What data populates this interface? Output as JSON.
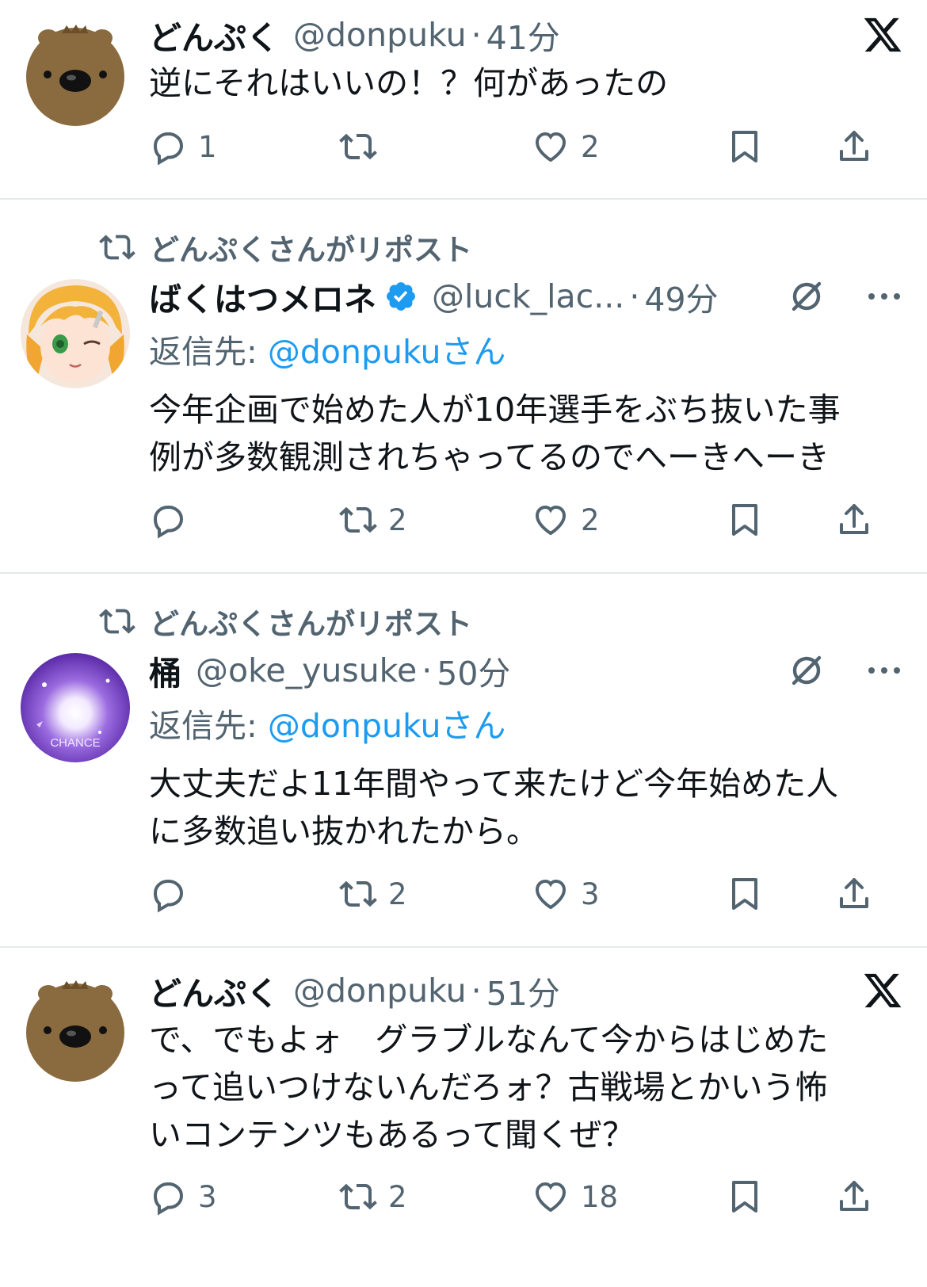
{
  "tweets": [
    {
      "name": "どんぷく",
      "handle": "@donpuku",
      "time": "41分",
      "text_lines": [
        "逆にそれはいいの！？何があったの"
      ],
      "counts": {
        "reply": "1",
        "repost": "",
        "like": "2"
      }
    },
    {
      "repost_label": "どんぷくさんがリポスト",
      "name": "ばくはつメロネ",
      "handle": "@luck_lac...",
      "time": "49分",
      "reply_prefix": "返信先: ",
      "reply_mention": "@donpukuさん",
      "text_lines": [
        "今年企画で始めた人が10年選手をぶち抜いた事",
        "例が多数観測されちゃってるのでへーきへーき"
      ],
      "counts": {
        "reply": "",
        "repost": "2",
        "like": "2"
      }
    },
    {
      "repost_label": "どんぷくさんがリポスト",
      "name": "桶",
      "handle": "@oke_yusuke",
      "time": "50分",
      "reply_prefix": "返信先: ",
      "reply_mention": "@donpukuさん",
      "text_lines": [
        "大丈夫だよ11年間やって来たけど今年始めた人",
        "に多数追い抜かれたから。"
      ],
      "counts": {
        "reply": "",
        "repost": "2",
        "like": "3"
      }
    },
    {
      "name": "どんぷく",
      "handle": "@donpuku",
      "time": "51分",
      "text_lines": [
        "で、でもよォ　グラブルなんて今からはじめた",
        "って追いつけないんだろォ？古戦場とかいう怖",
        "いコンテンツもあるって聞くぜ？"
      ],
      "counts": {
        "reply": "3",
        "repost": "2",
        "like": "18"
      }
    }
  ],
  "avatar_texts": {
    "chance": "CHANCE"
  },
  "colors": {
    "text": "#0f1419",
    "secondary": "#536471",
    "link": "#1d9bf0",
    "divider": "#e6e9eb"
  }
}
